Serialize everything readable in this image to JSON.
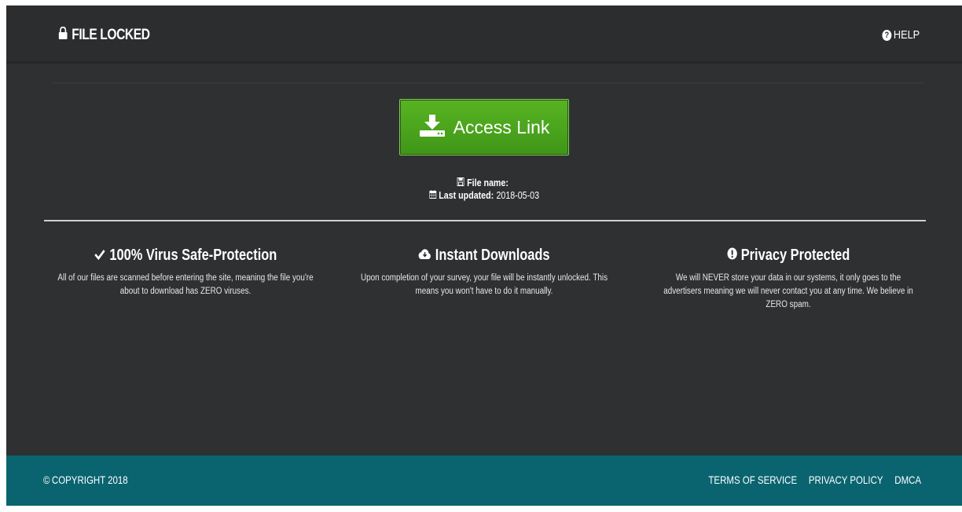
{
  "header": {
    "title": "FILE LOCKED",
    "help_label": "HELP"
  },
  "main": {
    "access_button_label": "Access Link",
    "file_name_label": "File name:",
    "file_name_value": "",
    "last_updated_label": "Last updated:",
    "last_updated_value": "2018-05-03"
  },
  "features": [
    {
      "title": "100% Virus Safe-Protection",
      "description": "All of our files are scanned before entering the site, meaning the file you're about to download has ZERO viruses.",
      "icon": "check-icon"
    },
    {
      "title": "Instant Downloads",
      "description": "Upon completion of your survey, your file will be instantly unlocked. This means you won't have to do it manually.",
      "icon": "cloud-download-icon"
    },
    {
      "title": "Privacy Protected",
      "description": "We will NEVER store your data in our systems, it only goes to the advertisers meaning we will never contact you at any time. We believe in ZERO spam.",
      "icon": "exclamation-circle-icon"
    }
  ],
  "footer": {
    "copyright": "COPYRIGHT 2018",
    "links": [
      "TERMS OF SERVICE",
      "PRIVACY POLICY",
      "DMCA"
    ]
  },
  "colors": {
    "background": "#2f3031",
    "button_green": "#4ea51d",
    "footer_teal": "#0a6470"
  }
}
